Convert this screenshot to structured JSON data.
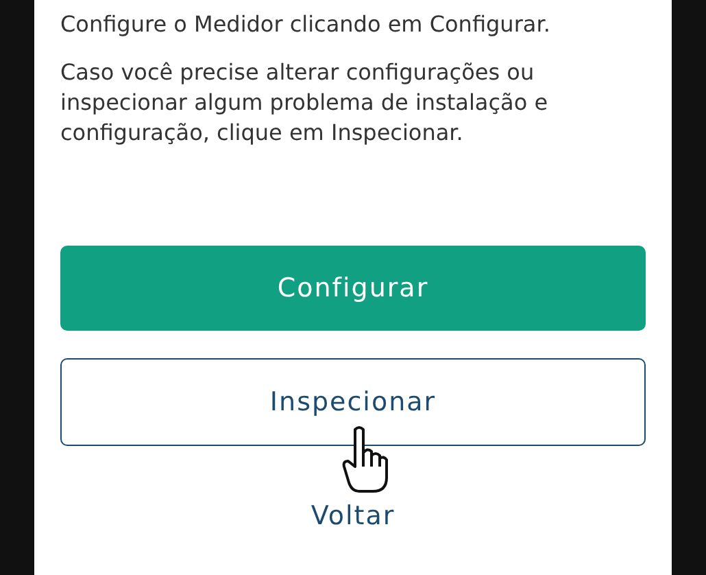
{
  "paragraphs": [
    "Configure o Medidor clicando em Configurar.",
    "Caso você precise alterar configurações ou inspecionar algum problema de instalação e configuração, clique em Inspecionar."
  ],
  "buttons": [
    {
      "label": "Configurar",
      "kind": "filled"
    },
    {
      "label": "Inspecionar",
      "kind": "outline"
    }
  ],
  "back_link": "Voltar"
}
